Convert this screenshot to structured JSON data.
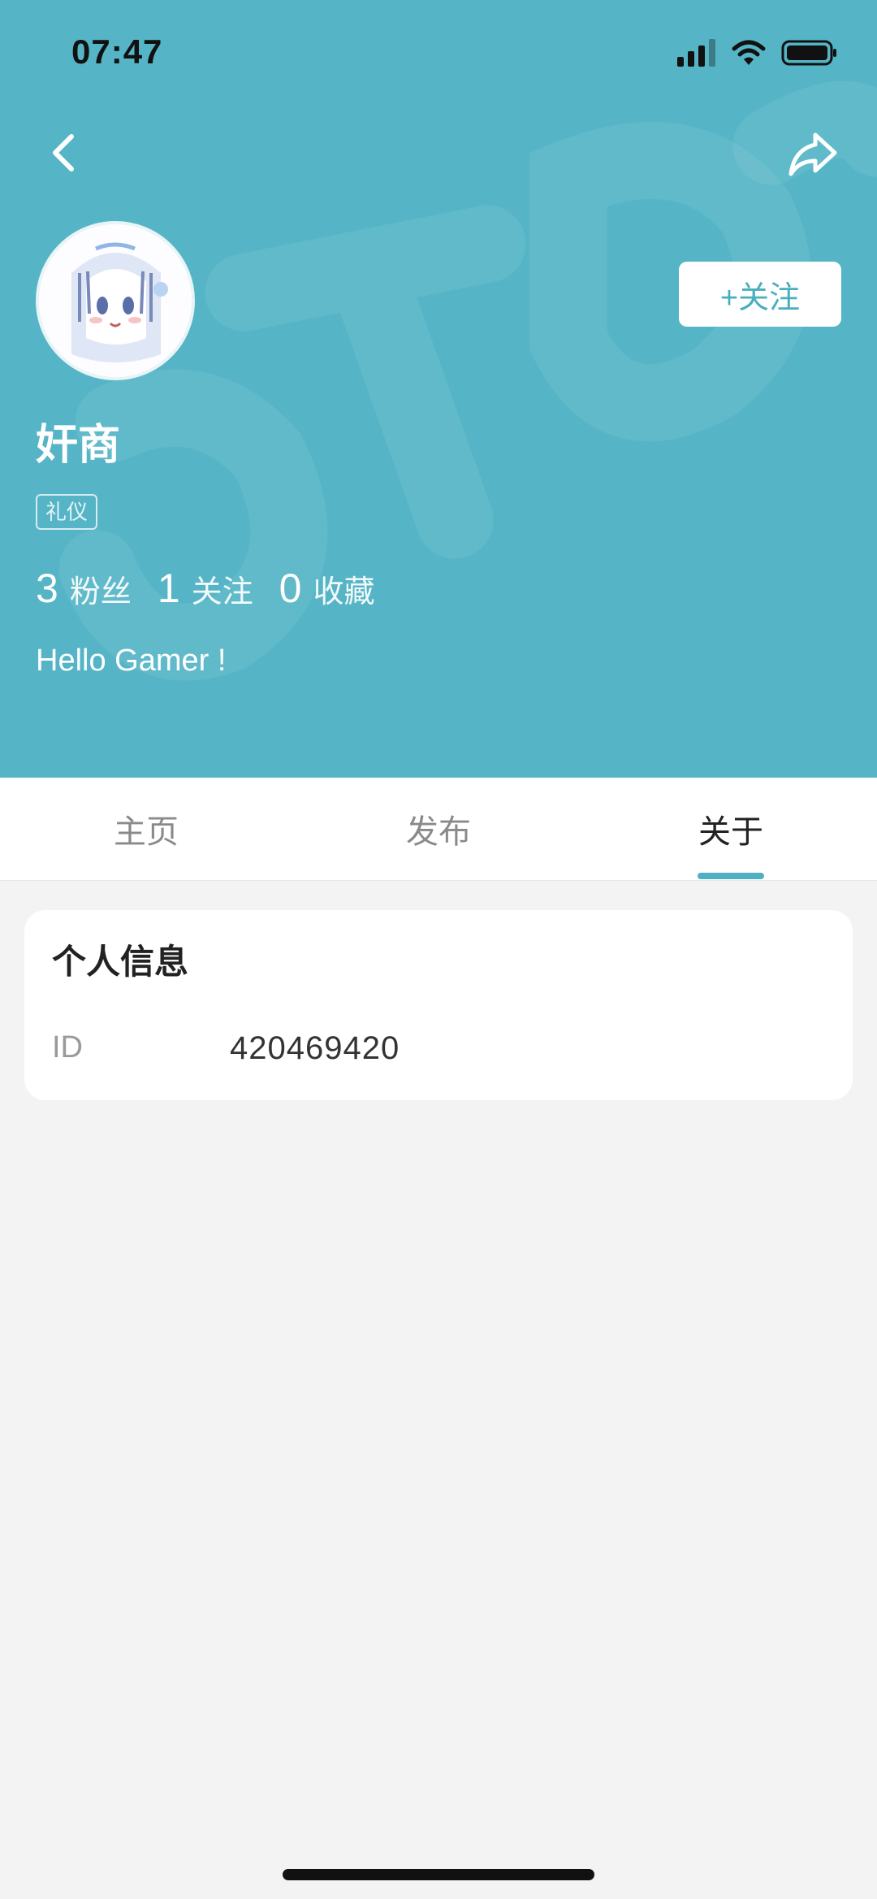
{
  "status_bar": {
    "time": "07:47"
  },
  "profile": {
    "follow_label": "+关注",
    "username": "奸商",
    "tag": "礼仪",
    "stats": [
      {
        "num": "3",
        "label": "粉丝"
      },
      {
        "num": "1",
        "label": "关注"
      },
      {
        "num": "0",
        "label": "收藏"
      }
    ],
    "bio": "Hello Gamer !"
  },
  "tabs": [
    "主页",
    "发布",
    "关于"
  ],
  "active_tab": "关于",
  "info_card": {
    "title": "个人信息",
    "rows": [
      {
        "label": "ID",
        "value": "420469420"
      }
    ]
  },
  "colors": {
    "header_bg": "#55b5c6",
    "accent": "#4eb0c2",
    "page_bg": "#f3f3f3"
  }
}
